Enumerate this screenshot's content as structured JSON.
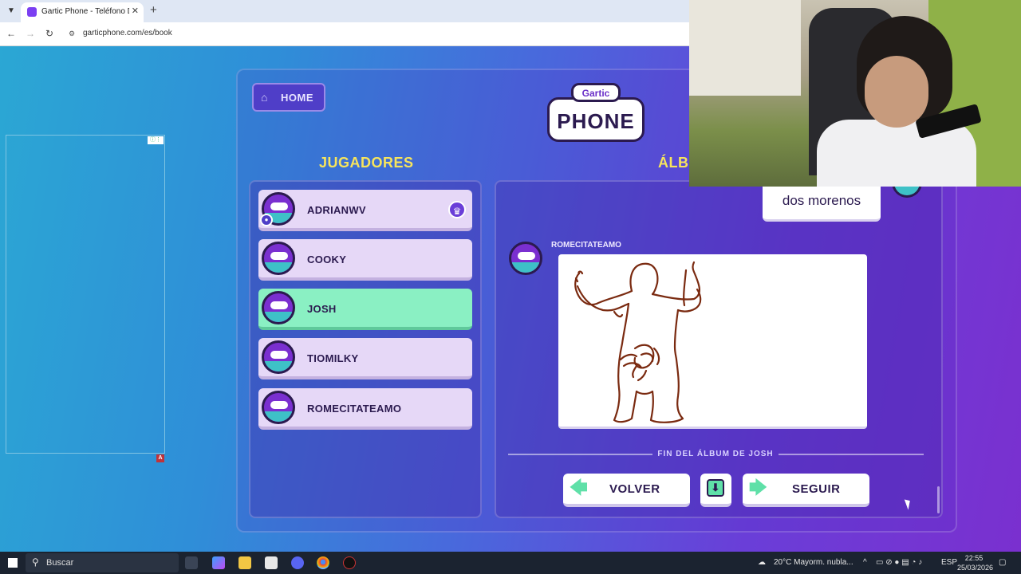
{
  "browser": {
    "tab_title": "Gartic Phone - Teléfono Descon",
    "url": "garticphone.com/es/book"
  },
  "game": {
    "home_label": "HOME",
    "logo_top": "Gartic",
    "logo_main": "PHONE",
    "players_title": "JUGADORES",
    "album_title": "ÁLB",
    "players": [
      {
        "name": "ADRIANWV",
        "host": true,
        "active": false
      },
      {
        "name": "COOKY",
        "host": false,
        "active": false
      },
      {
        "name": "JOSH",
        "host": false,
        "active": true
      },
      {
        "name": "TIOMILKY",
        "host": false,
        "active": false
      },
      {
        "name": "ROMECITATEAMO",
        "host": false,
        "active": false
      }
    ],
    "album": {
      "previous_text": "dos morenos",
      "author": "ROMECITATEAMO",
      "end_label": "FIN DEL ÁLBUM DE JOSH",
      "back_label": "VOLVER",
      "next_label": "SEGUIR"
    }
  },
  "colors": {
    "title_yellow": "#f7e55c",
    "active_player": "#8af0c3",
    "player_bg": "#e6d8f7",
    "accent_green": "#5fe0a8"
  },
  "taskbar": {
    "search_placeholder": "Buscar",
    "weather": "20°C  Mayorm. nubla...",
    "language": "ESP",
    "time": "22:55",
    "date": "25/03/2026"
  }
}
